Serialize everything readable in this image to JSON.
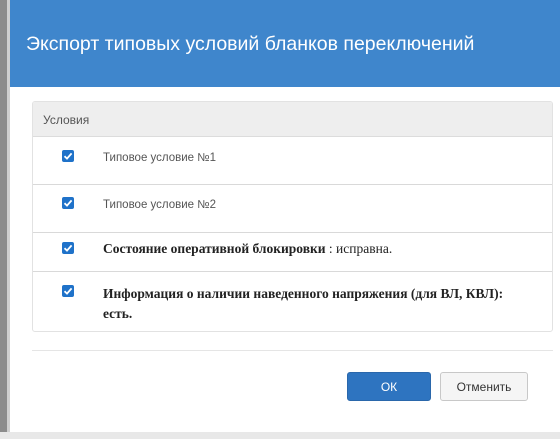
{
  "dialog": {
    "title": "Экспорт типовых условий бланков переключений"
  },
  "conditions_panel": {
    "header": "Условия",
    "items": [
      {
        "checked": true,
        "text": "Типовое условие №1"
      },
      {
        "checked": true,
        "text": "Типовое условие №2"
      },
      {
        "checked": true,
        "bold_text": "Состояние оперативной блокировки",
        "text": " : исправна."
      },
      {
        "checked": true,
        "bold_text": "Информация о наличии наведенного напряжения (для ВЛ, КВЛ): есть."
      }
    ]
  },
  "footer": {
    "ok_label": "ОК",
    "cancel_label": "Отменить"
  },
  "colors": {
    "title_bar": "#3f86cc",
    "checkbox": "#1f72c9",
    "ok_button": "#2e74c0"
  }
}
